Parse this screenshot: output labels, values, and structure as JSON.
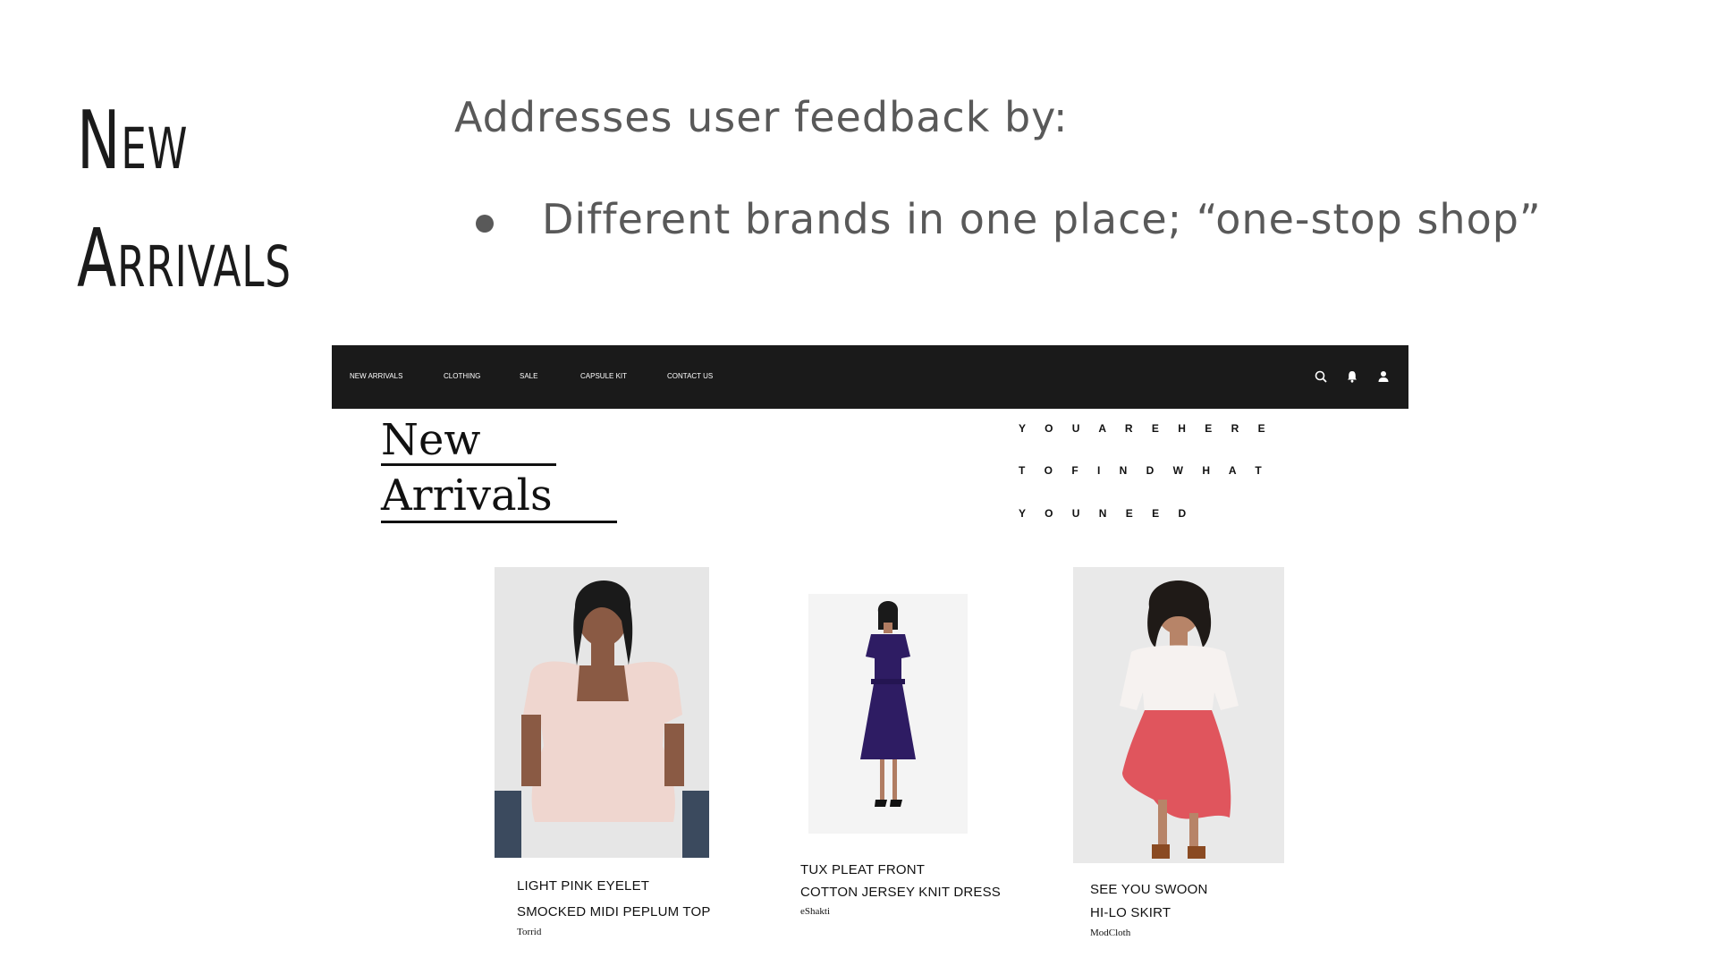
{
  "slide": {
    "title_lines": [
      "New",
      "Arrivals"
    ],
    "heading": "Addresses user feedback by:",
    "bullet": "Different brands in one place; “one-stop shop”"
  },
  "site": {
    "nav": {
      "items": [
        "NEW ARRIVALS",
        "CLOTHING",
        "SALE",
        "CAPSULE KIT",
        "CONTACT US"
      ],
      "icons": [
        "search-icon",
        "bell-icon",
        "user-icon"
      ],
      "background": "#1a1a1a"
    },
    "page_heading_lines": [
      "New",
      "Arrivals"
    ],
    "tagline": [
      "Y O U   A R E   H E R E",
      "T O   F I N D   W H A T",
      "Y O U   N E E D"
    ],
    "products": [
      {
        "line1": "LIGHT PINK EYELET",
        "line2": "SMOCKED MIDI PEPLUM TOP",
        "brand": "Torrid"
      },
      {
        "line1": "TUX PLEAT FRONT",
        "line2": "COTTON JERSEY KNIT DRESS",
        "brand": "eShakti"
      },
      {
        "line1": "SEE YOU SWOON",
        "line2": "HI-LO SKIRT",
        "brand": "ModCloth"
      }
    ]
  }
}
